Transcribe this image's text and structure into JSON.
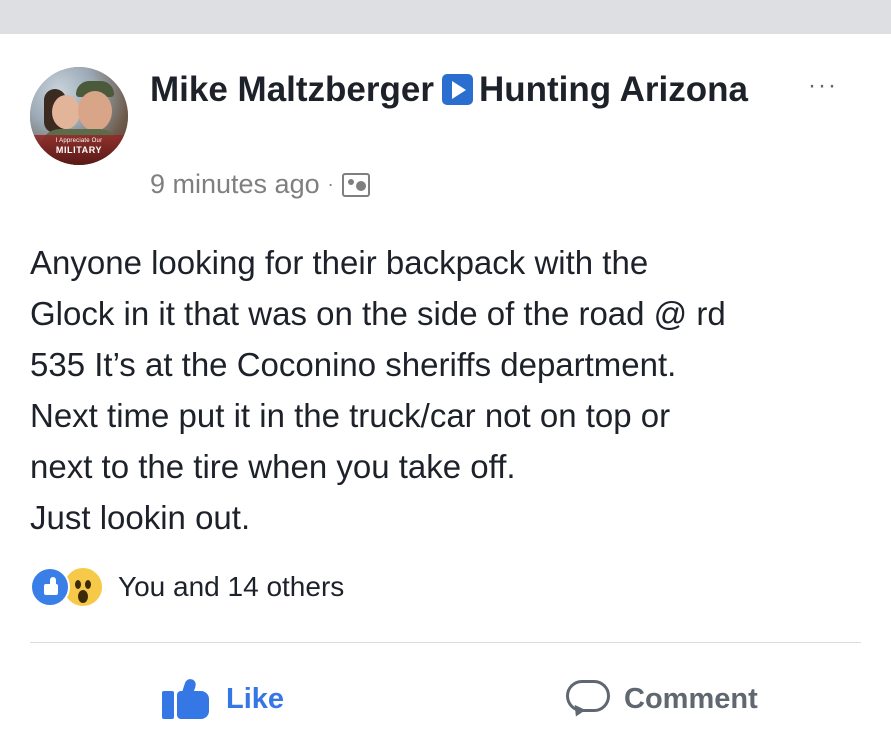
{
  "post": {
    "author": "Mike Maltzberger",
    "group": "Hunting Arizona",
    "timestamp": "9 minutes ago",
    "meta_separator": "·",
    "audience_icon": "photo-icon",
    "more_label": "···",
    "avatar_badge": {
      "small_text": "I Appreciate Our",
      "big_text": "MILITARY"
    },
    "body_lines": [
      "Anyone looking for their backpack with the",
      "Glock in it that was on the side of the road @ rd",
      "535 It’s at the Coconino sheriffs department.",
      "Next time put it in the truck/car not on top or",
      "next to the tire when you take off.",
      "Just lookin out."
    ],
    "reactions": {
      "types": [
        "like",
        "wow"
      ],
      "summary": "You and 14 others"
    }
  },
  "actions": {
    "like_label": "Like",
    "comment_label": "Comment"
  },
  "colors": {
    "accent": "#3578e5",
    "text": "#1d2129",
    "meta": "#7f7f7f",
    "divider": "#dadde1"
  }
}
